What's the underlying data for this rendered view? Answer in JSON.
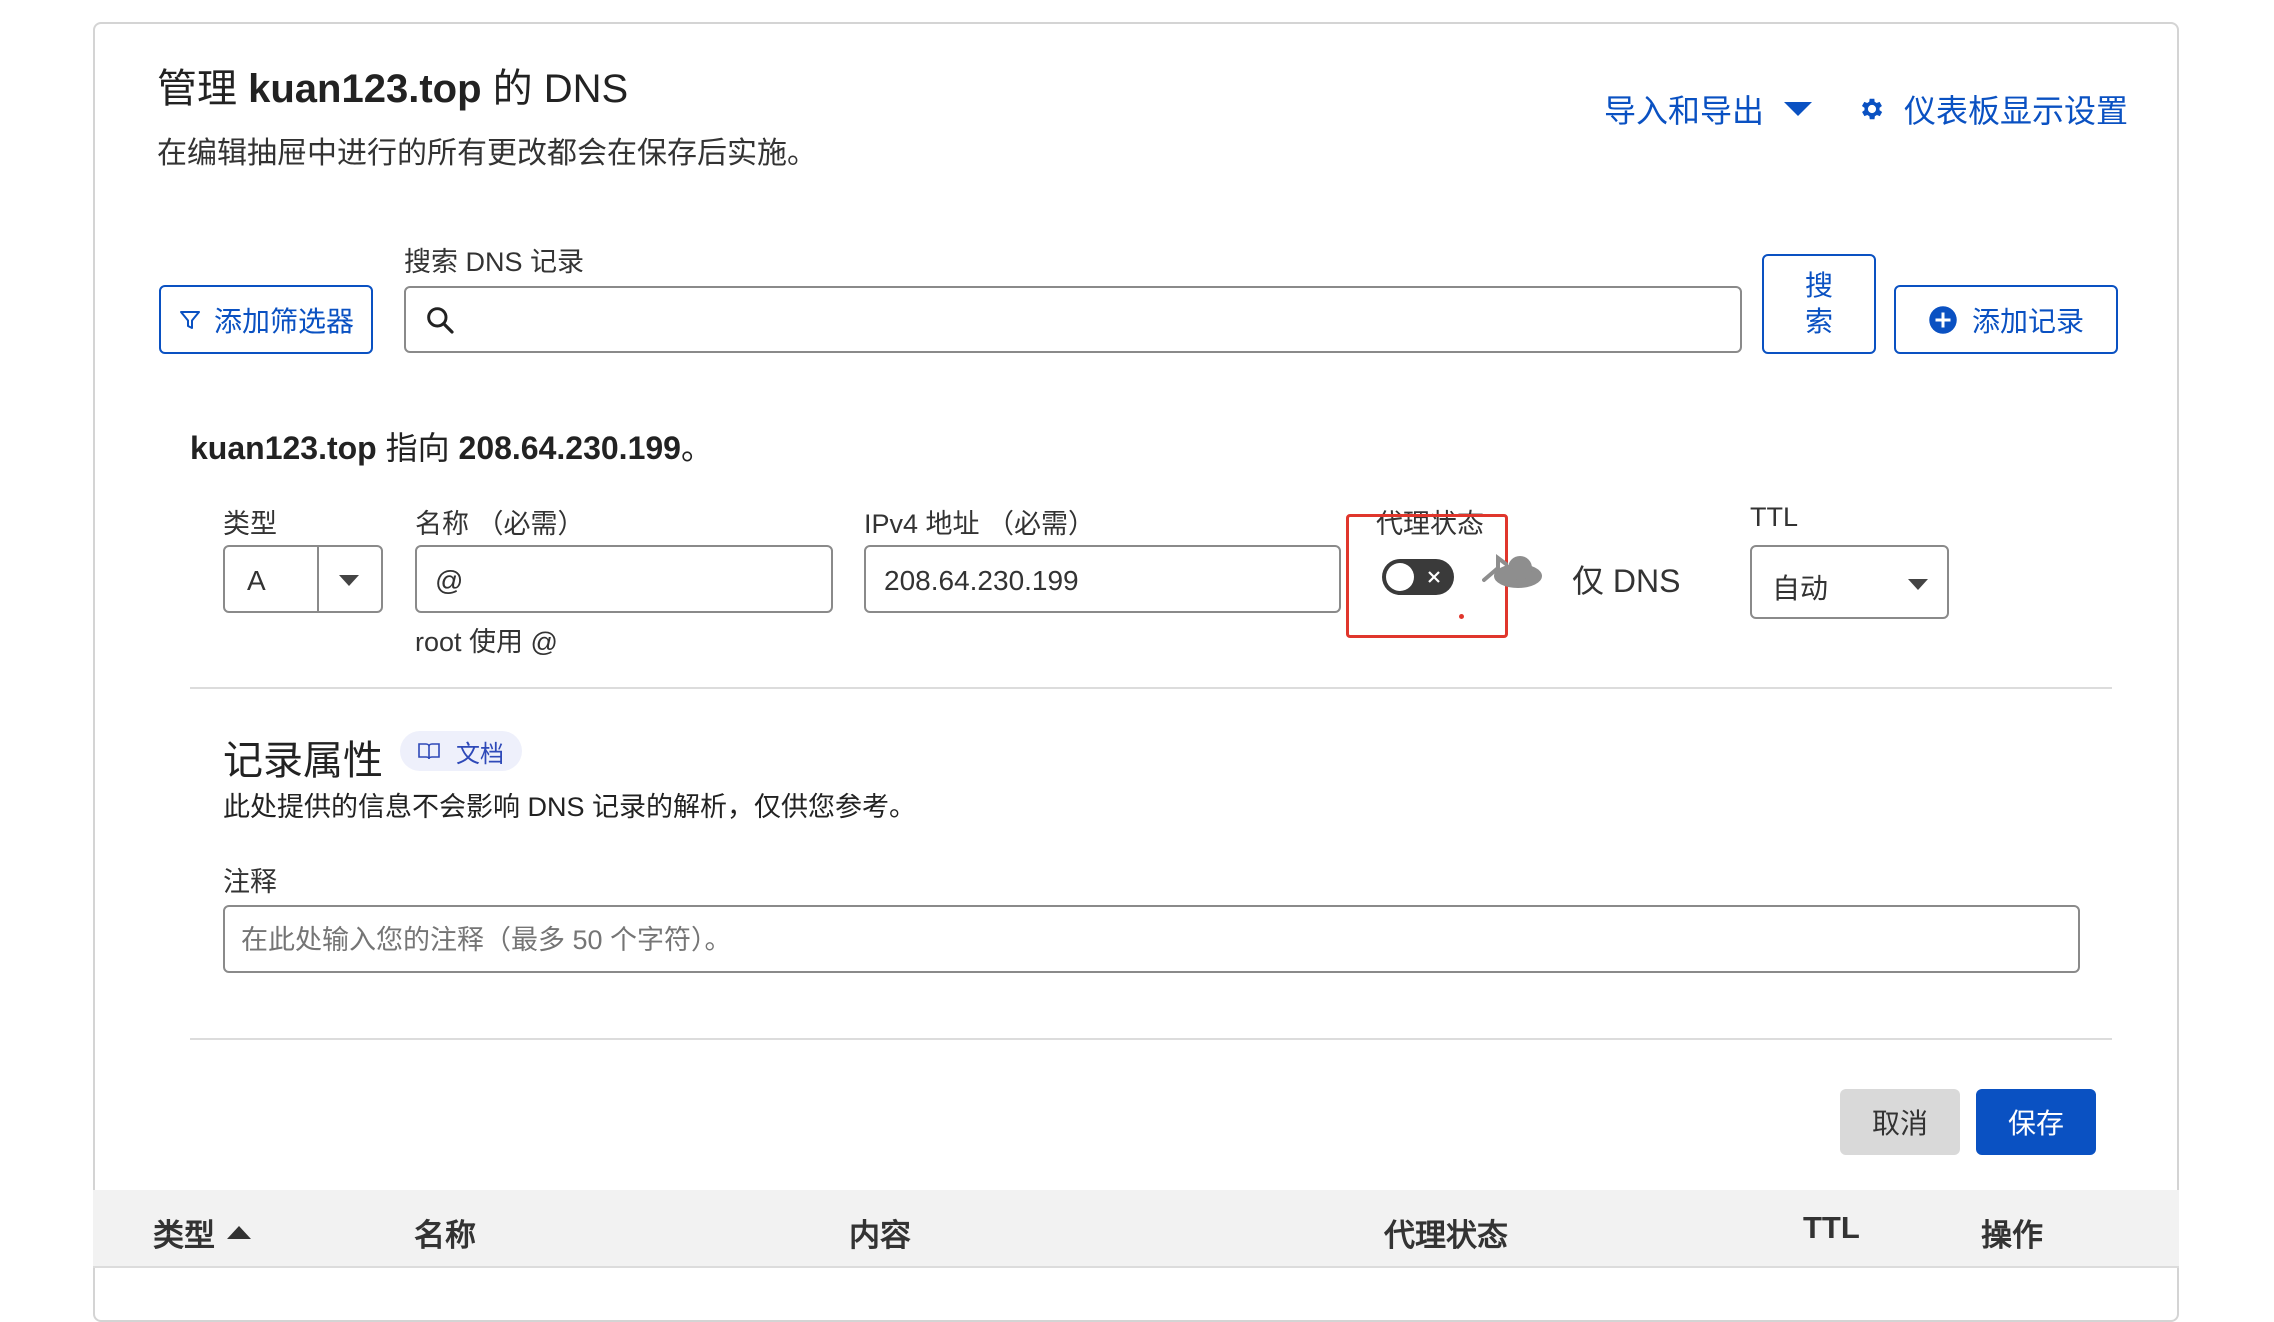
{
  "header": {
    "title_prefix": "管理",
    "domain": "kuan123.top",
    "title_suffix": "的 DNS",
    "subtitle": "在编辑抽屉中进行的所有更改都会在保存后实施。",
    "import_export_label": "导入和导出",
    "dashboard_settings_label": "仪表板显示设置"
  },
  "toolbar": {
    "add_filter_label": "添加筛选器",
    "search_label": "搜索 DNS 记录",
    "search_placeholder": "",
    "search_button_label": "搜索",
    "add_record_label": "添加记录"
  },
  "record_editor": {
    "points_to_domain": "kuan123.top",
    "points_to_text": "指向",
    "points_to_ip": "208.64.230.199",
    "points_to_end": "。",
    "type_label": "类型",
    "type_value": "A",
    "name_label": "名称 （必需）",
    "name_value": "@",
    "name_hint": "root 使用 @",
    "ipv4_label": "IPv4 地址 （必需）",
    "ipv4_value": "208.64.230.199",
    "proxy_label": "代理状态",
    "proxy_enabled": false,
    "proxy_status_text": "仅 DNS",
    "ttl_label": "TTL",
    "ttl_value": "自动"
  },
  "record_attributes": {
    "heading": "记录属性",
    "docs_label": "文档",
    "description": "此处提供的信息不会影响 DNS 记录的解析，仅供您参考。",
    "comment_label": "注释",
    "comment_placeholder": "在此处输入您的注释（最多 50 个字符）。"
  },
  "actions": {
    "cancel_label": "取消",
    "save_label": "保存"
  },
  "table": {
    "columns": [
      "类型",
      "名称",
      "内容",
      "代理状态",
      "TTL",
      "操作"
    ]
  },
  "colors": {
    "accent": "#0a51c2",
    "highlight": "#e0362c"
  },
  "icons": [
    "chevron-down-icon",
    "gear-icon",
    "filter-icon",
    "search-icon",
    "plus-circle-icon",
    "close-icon",
    "cloud-icon",
    "book-icon",
    "sort-ascending-icon"
  ]
}
